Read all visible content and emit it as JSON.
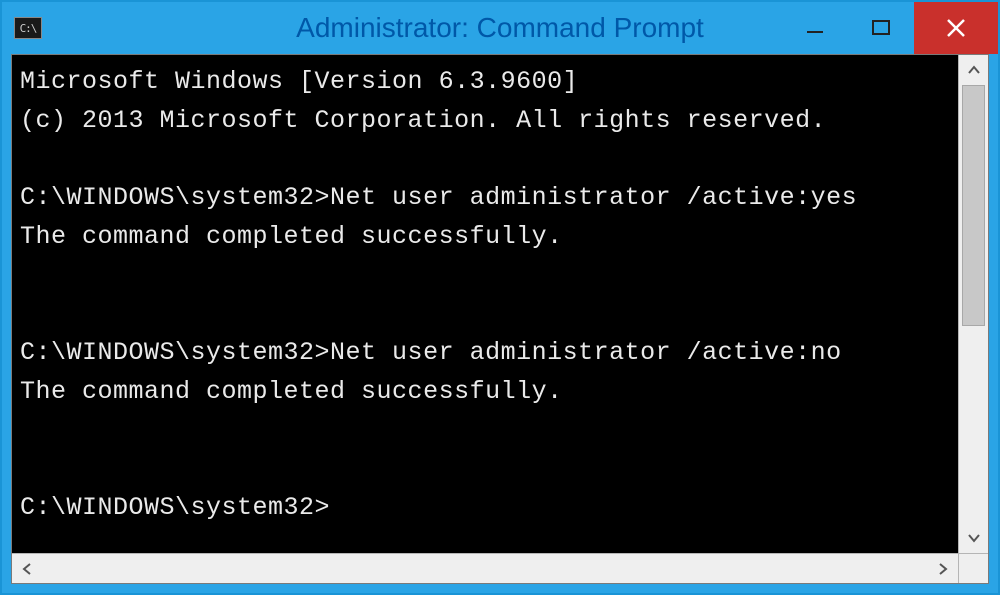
{
  "titlebar": {
    "icon_label": "C:\\",
    "title": "Administrator: Command Prompt"
  },
  "console": {
    "lines": [
      "Microsoft Windows [Version 6.3.9600]",
      "(c) 2013 Microsoft Corporation. All rights reserved.",
      "",
      "C:\\WINDOWS\\system32>Net user administrator /active:yes",
      "The command completed successfully.",
      "",
      "",
      "C:\\WINDOWS\\system32>Net user administrator /active:no",
      "The command completed successfully.",
      "",
      "",
      "C:\\WINDOWS\\system32>"
    ]
  },
  "colors": {
    "window_chrome": "#2aa4e6",
    "title_text": "#0058a8",
    "close_button": "#c9302c",
    "console_bg": "#000000",
    "console_fg": "#eaeaea"
  }
}
